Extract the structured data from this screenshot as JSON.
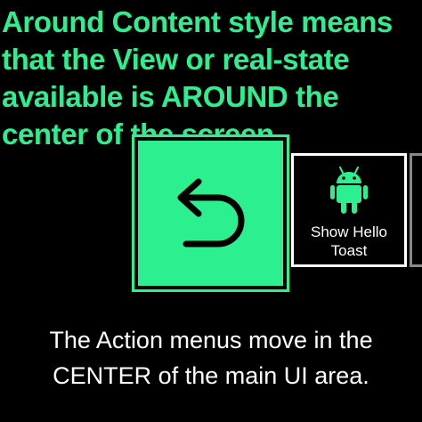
{
  "screen": {
    "background_color": "#000000",
    "accent_color": "#2cf08f"
  },
  "header": {
    "text": "Around Content style means that the View or real-state available is AROUND the center of the screen."
  },
  "actions": {
    "primary": {
      "icon": "undo-arrow-icon",
      "background_color": "#2cf08f"
    },
    "secondary": {
      "icon": "android-icon",
      "label": "Show Hello\nToast"
    }
  },
  "footer": {
    "text": "The Action menus move in the CENTER of the main UI area."
  }
}
